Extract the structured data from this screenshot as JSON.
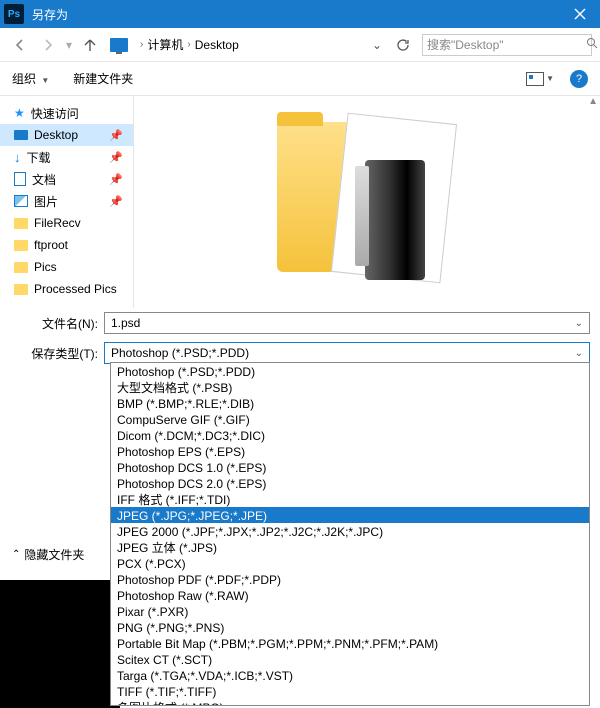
{
  "titlebar": {
    "title": "另存为"
  },
  "nav": {
    "crumb1": "计算机",
    "crumb2": "Desktop",
    "search_placeholder": "搜索\"Desktop\""
  },
  "toolbar": {
    "organize": "组织",
    "newfolder": "新建文件夹"
  },
  "sidebar": {
    "items": [
      {
        "label": "快速访问",
        "icon": "star"
      },
      {
        "label": "Desktop",
        "icon": "desktop",
        "pin": true,
        "selected": true
      },
      {
        "label": "下载",
        "icon": "download",
        "pin": true
      },
      {
        "label": "文档",
        "icon": "doc",
        "pin": true
      },
      {
        "label": "图片",
        "icon": "pic",
        "pin": true
      },
      {
        "label": "FileRecv",
        "icon": "folder"
      },
      {
        "label": "ftproot",
        "icon": "folder"
      },
      {
        "label": "Pics",
        "icon": "folder"
      },
      {
        "label": "Processed Pics",
        "icon": "folder"
      }
    ]
  },
  "form": {
    "filename_label": "文件名(N):",
    "filename_value": "1.psd",
    "type_label": "保存类型(T):",
    "type_value": "Photoshop (*.PSD;*.PDD)"
  },
  "filetypes": [
    "Photoshop (*.PSD;*.PDD)",
    "大型文档格式 (*.PSB)",
    "BMP (*.BMP;*.RLE;*.DIB)",
    "CompuServe GIF (*.GIF)",
    "Dicom (*.DCM;*.DC3;*.DIC)",
    "Photoshop EPS (*.EPS)",
    "Photoshop DCS 1.0 (*.EPS)",
    "Photoshop DCS 2.0 (*.EPS)",
    "IFF 格式 (*.IFF;*.TDI)",
    "JPEG (*.JPG;*.JPEG;*.JPE)",
    "JPEG 2000 (*.JPF;*.JPX;*.JP2;*.J2C;*.J2K;*.JPC)",
    "JPEG 立体 (*.JPS)",
    "PCX (*.PCX)",
    "Photoshop PDF (*.PDF;*.PDP)",
    "Photoshop Raw (*.RAW)",
    "Pixar (*.PXR)",
    "PNG (*.PNG;*.PNS)",
    "Portable Bit Map (*.PBM;*.PGM;*.PPM;*.PNM;*.PFM;*.PAM)",
    "Scitex CT (*.SCT)",
    "Targa (*.TGA;*.VDA;*.ICB;*.VST)",
    "TIFF (*.TIF;*.TIFF)",
    "多图片格式 (*.MPO)"
  ],
  "filetype_highlight_index": 9,
  "bottom": {
    "hide_folders": "隐藏文件夹"
  }
}
